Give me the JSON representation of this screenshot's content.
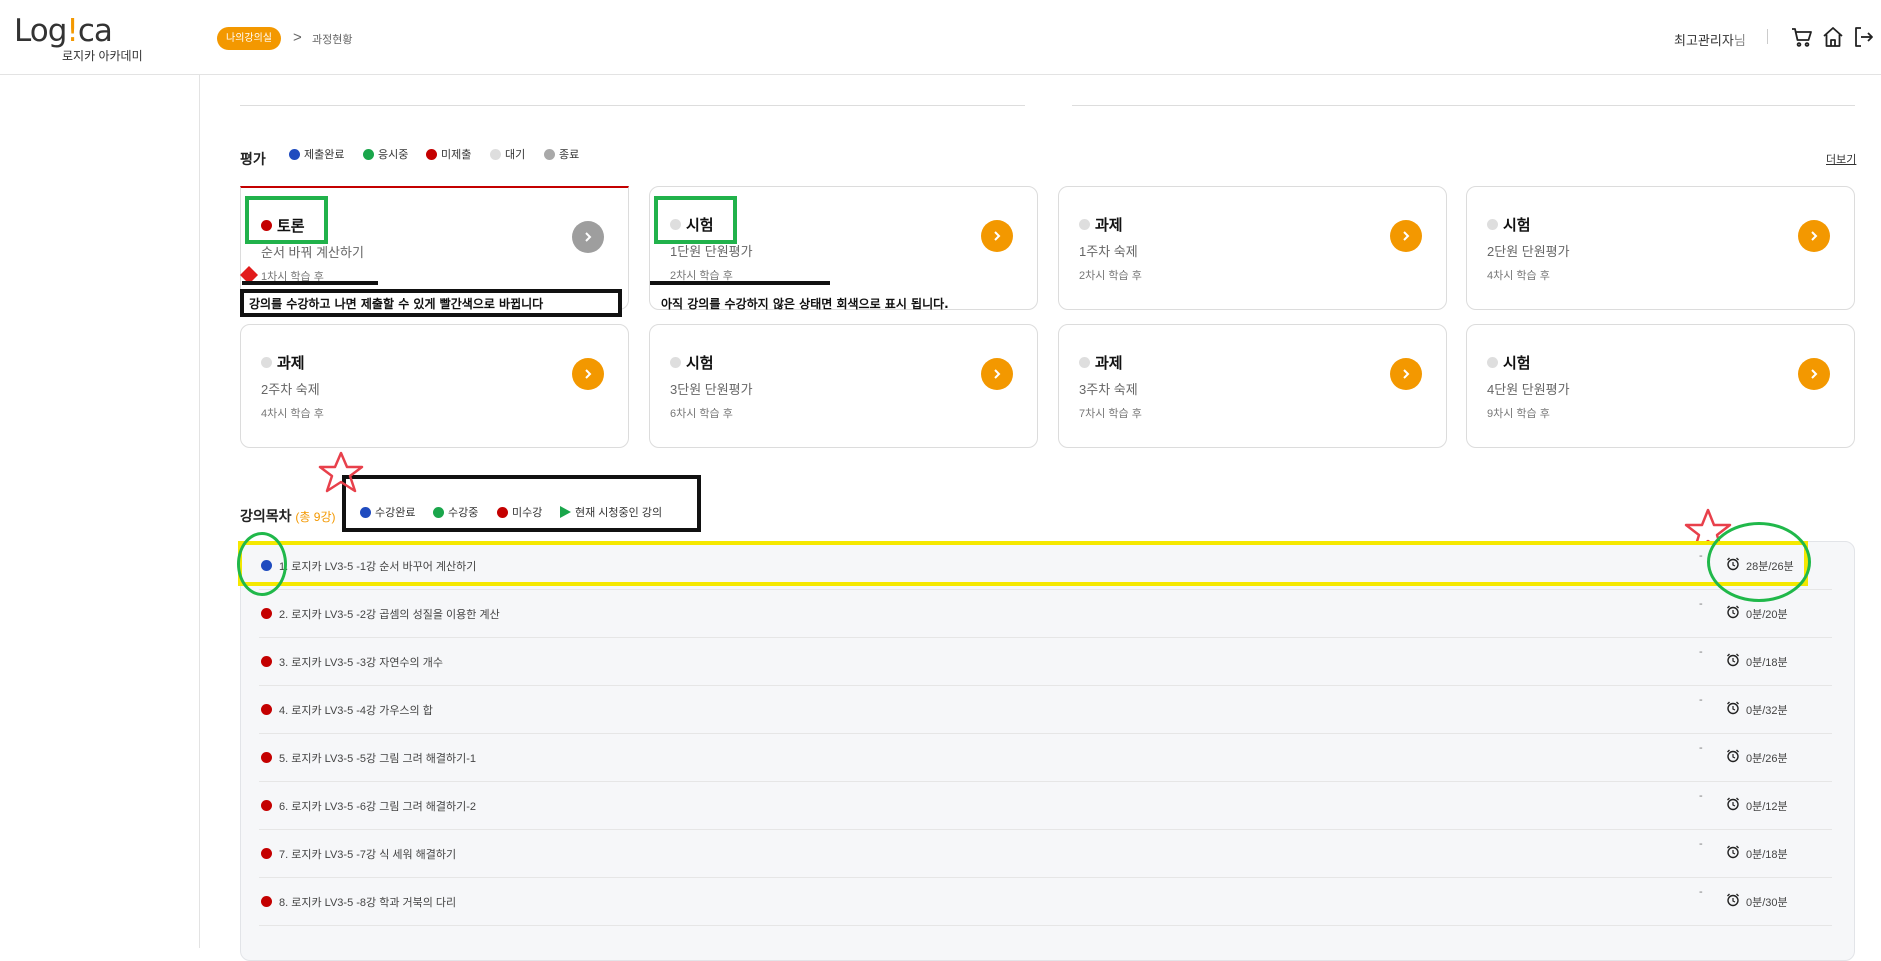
{
  "header": {
    "logo_text_main": "Log!ca",
    "logo_text_sub": "로지카 아카데미",
    "breadcrumb_active": "나의강의실",
    "breadcrumb_sep": ">",
    "breadcrumb_current": "과정현황",
    "user_name": "최고관리자",
    "user_suffix": "님",
    "icons": [
      "cart-icon",
      "home-icon",
      "logout-icon"
    ]
  },
  "evaluation": {
    "title": "평가",
    "more_label": "더보기",
    "legend": [
      {
        "label": "제출완료",
        "color": "#1f4bbf"
      },
      {
        "label": "응시중",
        "color": "#1aa64b"
      },
      {
        "label": "미제출",
        "color": "#c40000"
      },
      {
        "label": "대기",
        "color": "#dedede"
      },
      {
        "label": "종료",
        "color": "#a9a9a9"
      }
    ],
    "cards": [
      {
        "type": "토론",
        "name": "순서 바꿔 계산하기",
        "when": "1차시 학습 후",
        "status_color": "#c40000",
        "button": "gray"
      },
      {
        "type": "시험",
        "name": "1단원 단원평가",
        "when": "2차시 학습 후",
        "status_color": "#dedede",
        "button": "orange"
      },
      {
        "type": "과제",
        "name": "1주차 숙제",
        "when": "2차시 학습 후",
        "status_color": "#dedede",
        "button": "orange"
      },
      {
        "type": "시험",
        "name": "2단원 단원평가",
        "when": "4차시 학습 후",
        "status_color": "#dedede",
        "button": "orange"
      },
      {
        "type": "과제",
        "name": "2주차 숙제",
        "when": "4차시 학습 후",
        "status_color": "#dedede",
        "button": "orange"
      },
      {
        "type": "시험",
        "name": "3단원 단원평가",
        "when": "6차시 학습 후",
        "status_color": "#dedede",
        "button": "orange"
      },
      {
        "type": "과제",
        "name": "3주차 숙제",
        "when": "7차시 학습 후",
        "status_color": "#dedede",
        "button": "orange"
      },
      {
        "type": "시험",
        "name": "4단원 단원평가",
        "when": "9차시 학습 후",
        "status_color": "#dedede",
        "button": "orange"
      }
    ]
  },
  "annotations": {
    "note_red": "강의를 수강하고 나면 제출할 수 있게 빨간색으로 바뀝니다",
    "note_gray": "아직 강의를 수강하지 않은 상태면  회색으로 표시 됩니다."
  },
  "lectures": {
    "title": "강의목차",
    "count": "(총 9강)",
    "legend": [
      {
        "label": "수강완료",
        "color": "#1f4bbf",
        "shape": "dot"
      },
      {
        "label": "수강중",
        "color": "#1aa64b",
        "shape": "dot"
      },
      {
        "label": "미수강",
        "color": "#c40000",
        "shape": "dot"
      },
      {
        "label": "현재 시청중인 강의",
        "color": "#1aa64b",
        "shape": "triangle"
      }
    ],
    "rows": [
      {
        "title": "1. 로지카 LV3-5 -1강 순서 바꾸어 계산하기",
        "dash": "-",
        "time": "28분/26분",
        "status_color": "#1f4bbf"
      },
      {
        "title": "2. 로지카 LV3-5 -2강 곱셈의 성질을 이용한 계산",
        "dash": "-",
        "time": "0분/20분",
        "status_color": "#c40000"
      },
      {
        "title": "3. 로지카 LV3-5 -3강 자연수의 개수",
        "dash": "-",
        "time": "0분/18분",
        "status_color": "#c40000"
      },
      {
        "title": "4. 로지카 LV3-5 -4강 가우스의 합",
        "dash": "-",
        "time": "0분/32분",
        "status_color": "#c40000"
      },
      {
        "title": "5. 로지카 LV3-5 -5강 그림 그려 해결하기-1",
        "dash": "-",
        "time": "0분/26분",
        "status_color": "#c40000"
      },
      {
        "title": "6. 로지카 LV3-5 -6강 그림 그려 해결하기-2",
        "dash": "-",
        "time": "0분/12분",
        "status_color": "#c40000"
      },
      {
        "title": "7. 로지카 LV3-5 -7강 식 세워 해결하기",
        "dash": "-",
        "time": "0분/18분",
        "status_color": "#c40000"
      },
      {
        "title": "8. 로지카 LV3-5 -8강 학과 거북의 다리",
        "dash": "-",
        "time": "0분/30분",
        "status_color": "#c40000"
      }
    ]
  }
}
